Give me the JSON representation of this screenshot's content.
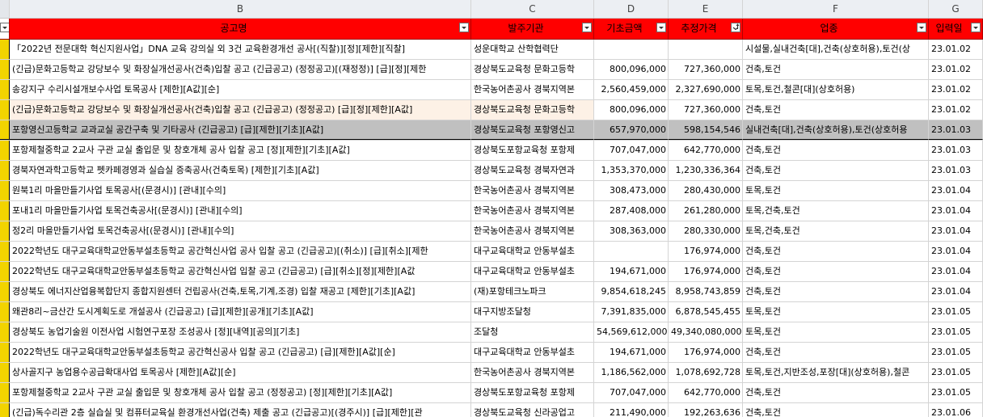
{
  "column_letters": [
    "B",
    "C",
    "D",
    "E",
    "F",
    "G"
  ],
  "headers": {
    "title": "공고명",
    "agency": "발주기관",
    "base_price": "기초금액",
    "estimated_price": "추정가격",
    "category": "업종",
    "date": "입력일"
  },
  "rows": [
    {
      "title": "「2022년 전문대학 혁신지원사업」DNA 교육 강의실 외 3건 교육환경개선 공사[(직찰)][정][제한][직찰]",
      "agency": "성운대학교 산학협력단",
      "base": "",
      "est": "",
      "cat": "시설물,실내건축[대],건축(상호허용),토건(상",
      "date": "23.01.02"
    },
    {
      "title": "(긴급)문화고등학교 강당보수 및 화장실개선공사(건축)입찰 공고 (긴급공고) (정정공고)[(재정정)] [급][정][제한",
      "agency": "경상북도교육청 문화고등학",
      "base": "800,096,000",
      "est": "727,360,000",
      "cat": "건축,토건",
      "date": "23.01.02"
    },
    {
      "title": "송강지구 수리시설개보수사업 토목공사 [제한][A값][순]",
      "agency": "한국농어촌공사 경북지역본",
      "base": "2,560,459,000",
      "est": "2,327,690,000",
      "cat": "토목,토건,철콘[대](상호허용)",
      "date": "23.01.02"
    },
    {
      "title": "(긴급)문화고등학교 강당보수 및 화장실개선공사(건축)입찰 공고 (긴급공고) (정정공고) [급][정][제한][A값]",
      "agency": "경상북도교육청 문화고등학",
      "base": "800,096,000",
      "est": "727,360,000",
      "cat": "건축,토건",
      "date": "23.01.02"
    },
    {
      "title": "포항영신고등학교 교과교실 공간구축 및 기타공사 (긴급공고) [급][제한][기초][A값]",
      "agency": "경상북도교육청 포항영신고",
      "base": "657,970,000",
      "est": "598,154,546",
      "cat": "실내건축[대],건축(상호허용),토건(상호허용",
      "date": "23.01.03"
    },
    {
      "title": "포항제철중학교 2교사 구관 교실 출입문 및 창호개체 공사 입찰 공고 [정][제한][기초][A값]",
      "agency": "경상북도포항교육청 포항제",
      "base": "707,047,000",
      "est": "642,770,000",
      "cat": "건축,토건",
      "date": "23.01.03"
    },
    {
      "title": "경북자연과학고등학교 펫카페경영과 실습실 증축공사(건축토목) [제한][기초][A값]",
      "agency": "경상북도교육청 경북자연과",
      "base": "1,353,370,000",
      "est": "1,230,336,364",
      "cat": "건축,토건",
      "date": "23.01.03"
    },
    {
      "title": "원북1리 마을만들기사업 토목공사[(문경시)] [관내][수의]",
      "agency": "한국농어촌공사 경북지역본",
      "base": "308,473,000",
      "est": "280,430,000",
      "cat": "토목,토건",
      "date": "23.01.04"
    },
    {
      "title": "포내1리 마을만들기사업 토목건축공사[(문경시)] [관내][수의]",
      "agency": "한국농어촌공사 경북지역본",
      "base": "287,408,000",
      "est": "261,280,000",
      "cat": "토목,건축,토건",
      "date": "23.01.04"
    },
    {
      "title": "정2리 마을만들기사업 토목건축공사[(문경시)] [관내][수의]",
      "agency": "한국농어촌공사 경북지역본",
      "base": "308,363,000",
      "est": "280,330,000",
      "cat": "토목,건축,토건",
      "date": "23.01.04"
    },
    {
      "title": "2022학년도 대구교육대학교안동부설초등학교 공간혁신사업 공사 입찰 공고 (긴급공고)[(취소)] [급][취소][제한",
      "agency": "대구교육대학교 안동부설초",
      "base": "",
      "est": "176,974,000",
      "cat": "건축,토건",
      "date": "23.01.04"
    },
    {
      "title": "2022학년도 대구교육대학교안동부설초등학교 공간혁신사업 입찰 공고 (긴급공고) [급][취소][정][제한][A값",
      "agency": "대구교육대학교 안동부설초",
      "base": "194,671,000",
      "est": "176,974,000",
      "cat": "건축,토건",
      "date": "23.01.04"
    },
    {
      "title": "경상북도 에너지산업융복합단지 종합지원센터 건립공사(건축,토목,기계,조경) 입찰 재공고 [제한][기초][A값]",
      "agency": "(재)포항테크노파크",
      "base": "9,854,618,245",
      "est": "8,958,743,859",
      "cat": "건축,토건",
      "date": "23.01.04"
    },
    {
      "title": "왜관8리~금산간 도시계획도로 개설공사 (긴급공고) [급][제한][공개][기초][A값]",
      "agency": "대구지방조달청",
      "base": "7,391,835,000",
      "est": "6,878,545,455",
      "cat": "토목,토건",
      "date": "23.01.05"
    },
    {
      "title": "경상북도 농업기술원 이전사업 시험연구포장 조성공사 [정][내역][공의][기초]",
      "agency": "조달청",
      "base": "54,569,612,000",
      "est": "49,340,080,000",
      "cat": "토목,토건",
      "date": "23.01.05"
    },
    {
      "title": "2022학년도 대구교육대학교안동부설초등학교 공간혁신공사 입찰 공고 (긴급공고) [급][제한][A값][순]",
      "agency": "대구교육대학교 안동부설초",
      "base": "194,671,000",
      "est": "176,974,000",
      "cat": "건축,토건",
      "date": "23.01.05"
    },
    {
      "title": "상사골지구 농업용수공급확대사업 토목공사 [제한][A값][순]",
      "agency": "한국농어촌공사 경북지역본",
      "base": "1,186,562,000",
      "est": "1,078,692,728",
      "cat": "토목,토건,지반조성,포장[대](상호허용),철콘",
      "date": "23.01.05"
    },
    {
      "title": "포항제철중학교 2교사 구관 교실 출입문 및 창호개체 공사 입찰 공고 (정정공고) [정][제한][기초][A값]",
      "agency": "경상북도포항교육청 포항제",
      "base": "707,047,000",
      "est": "642,770,000",
      "cat": "건축,토건",
      "date": "23.01.05"
    },
    {
      "title": "(긴급)독수리관 2층 실습실 및 컴퓨터교육실 환경개선사업(건축) 제출 공고 (긴급공고)[(경주시)] [급][제한][관",
      "agency": "경상북도교육청 신라공업고",
      "base": "211,490,000",
      "est": "192,263,636",
      "cat": "건축,토건",
      "date": "23.01.06"
    }
  ]
}
